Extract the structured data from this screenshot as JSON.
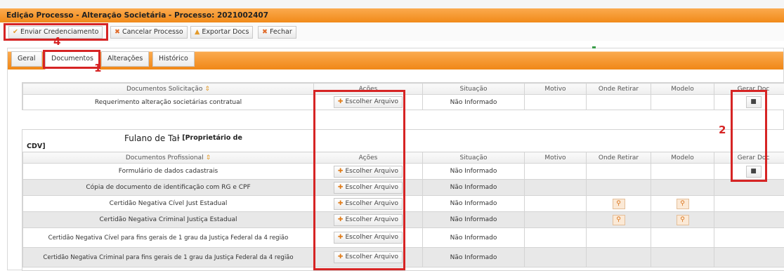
{
  "title": "Edição Processo - Alteração Societária - Processo: 2021002407",
  "toolbar": {
    "enviar": "Enviar Credenciamento",
    "cancelar": "Cancelar Processo",
    "exportar": "Exportar Docs",
    "fechar": "Fechar"
  },
  "tabs": [
    "Geral",
    "Documentos",
    "Alterações",
    "Histórico"
  ],
  "annotations": [
    "1",
    "2",
    "4"
  ],
  "table1": {
    "headers": [
      "Documentos Solicitação",
      "Ações",
      "Situação",
      "Motivo",
      "Onde Retirar",
      "Modelo",
      "Gerar Doc"
    ],
    "rows": [
      {
        "doc": "Requerimento alteração societárias contratual",
        "action": "Escolher Arquivo",
        "status": "Não Informado"
      }
    ]
  },
  "owner": {
    "name": "Fulano de Tal",
    "role": "- [Proprietário de",
    "role_cont": "CDV]"
  },
  "table2": {
    "headers": [
      "Documentos Profissional",
      "Ações",
      "Situação",
      "Motivo",
      "Onde Retirar",
      "Modelo",
      "Gerar Doc"
    ],
    "rows": [
      {
        "doc": "Formulário de dados cadastrais",
        "action": "Escolher Arquivo",
        "status": "Não Informado"
      },
      {
        "doc": "Cópia de documento de identificação com RG e CPF",
        "action": "Escolher Arquivo",
        "status": "Não Informado"
      },
      {
        "doc": "Certidão Negativa Cível Just Estadual",
        "action": "Escolher Arquivo",
        "status": "Não Informado"
      },
      {
        "doc": "Certidão Negativa Criminal Justiça Estadual",
        "action": "Escolher Arquivo",
        "status": "Não Informado"
      },
      {
        "doc": "Certidão Negativa Cível para fins gerais de 1 grau da Justiça Federal da 4 região",
        "action": "Escolher Arquivo",
        "status": "Não Informado"
      },
      {
        "doc": "Certidão Negativa Criminal para fins gerais de 1 grau da Justiça Federal da 4 região",
        "action": "Escolher Arquivo",
        "status": "Não Informado"
      }
    ]
  },
  "colors": {
    "orange_dark": "#f08717",
    "orange_light": "#fbaa4e",
    "highlight": "#d62424"
  }
}
